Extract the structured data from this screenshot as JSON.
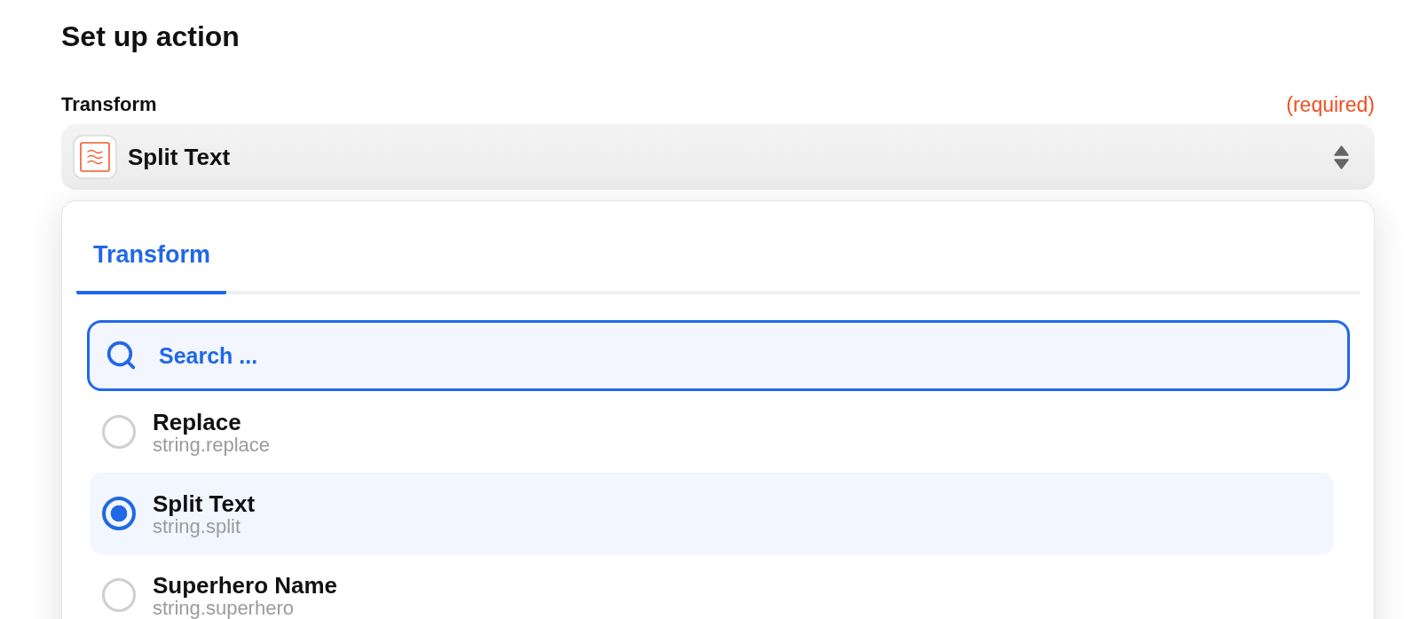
{
  "page": {
    "title": "Set up action"
  },
  "field": {
    "label": "Transform",
    "required_note": "(required)",
    "value": "Split Text"
  },
  "dropdown": {
    "tabs": [
      {
        "label": "Transform",
        "selected": true
      }
    ],
    "search": {
      "placeholder": "Search ..."
    },
    "options": [
      {
        "title": "Replace",
        "subtitle": "string.replace",
        "selected": false
      },
      {
        "title": "Split Text",
        "subtitle": "string.split",
        "selected": true
      },
      {
        "title": "Superhero Name",
        "subtitle": "string.superhero",
        "selected": false
      }
    ]
  }
}
